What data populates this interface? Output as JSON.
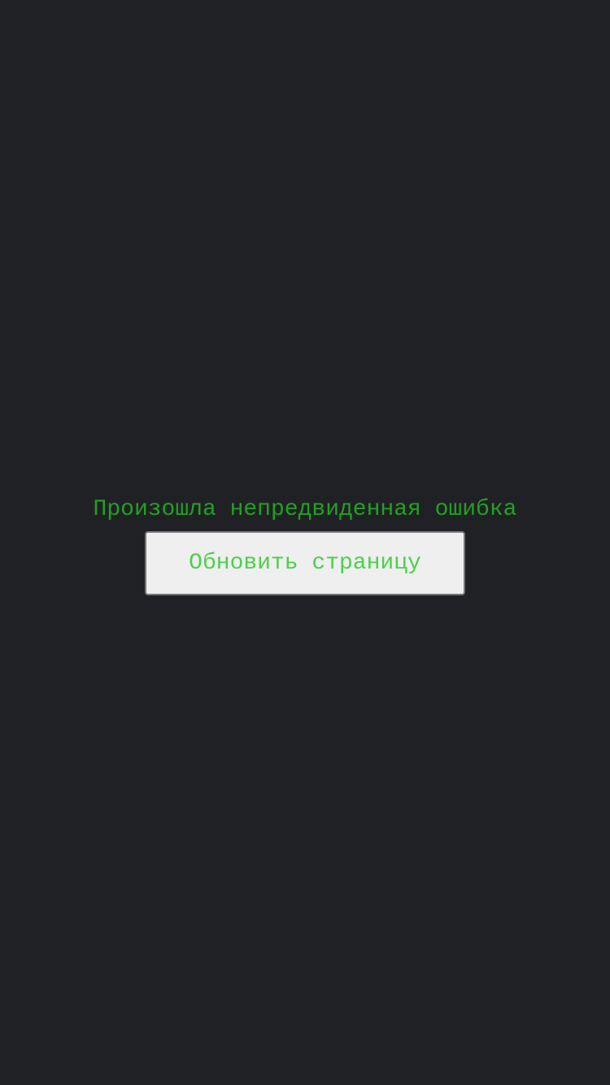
{
  "error": {
    "message": "Произошла непредвиденная ошибка",
    "reload_label": "Обновить страницу"
  },
  "colors": {
    "background": "#202125",
    "message_text": "#23a023",
    "button_text": "#4cd04c",
    "button_background": "#efefef",
    "button_border": "#767676"
  }
}
